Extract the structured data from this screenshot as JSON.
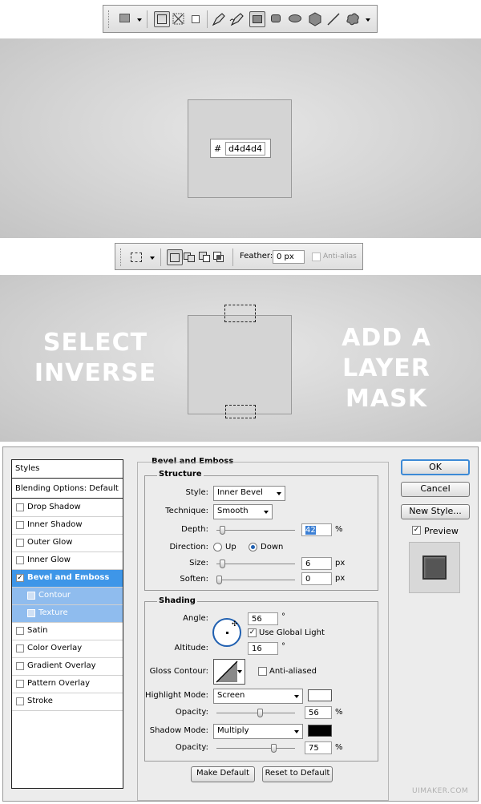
{
  "toolbar1": {
    "icons": [
      "shape-preset-icon",
      "shape-layers-icon",
      "paths-icon",
      "fill-pixels-icon",
      "pen-icon",
      "freeform-pen-icon",
      "rectangle-icon",
      "rounded-rectangle-icon",
      "ellipse-icon",
      "polygon-icon",
      "line-icon",
      "custom-shape-icon"
    ]
  },
  "step1": {
    "hash": "#",
    "hex": "d4d4d4",
    "fill_color": "#d4d4d4"
  },
  "toolbar2": {
    "feather_label": "Feather:",
    "feather_value": "0 px",
    "antialias_label": "Anti-alias"
  },
  "step2": {
    "left_text_line1": "SELECT",
    "left_text_line2": "INVERSE",
    "right_text_line1": "ADD A",
    "right_text_line2": "LAYER MASK"
  },
  "dialog": {
    "styles_header": "Styles",
    "blending": "Blending Options: Default",
    "items": [
      {
        "label": "Drop Shadow",
        "checked": false
      },
      {
        "label": "Inner Shadow",
        "checked": false
      },
      {
        "label": "Outer Glow",
        "checked": false
      },
      {
        "label": "Inner Glow",
        "checked": false
      },
      {
        "label": "Bevel and Emboss",
        "checked": true
      },
      {
        "label": "Contour",
        "checked": false
      },
      {
        "label": "Texture",
        "checked": false
      },
      {
        "label": "Satin",
        "checked": false
      },
      {
        "label": "Color Overlay",
        "checked": false
      },
      {
        "label": "Gradient Overlay",
        "checked": false
      },
      {
        "label": "Pattern Overlay",
        "checked": false
      },
      {
        "label": "Stroke",
        "checked": false
      }
    ],
    "section_title": "Bevel and Emboss",
    "structure": {
      "title": "Structure",
      "style_label": "Style:",
      "style_value": "Inner Bevel",
      "technique_label": "Technique:",
      "technique_value": "Smooth",
      "depth_label": "Depth:",
      "depth_value": "42",
      "depth_unit": "%",
      "depth_level": 0.04,
      "direction_label": "Direction:",
      "up_label": "Up",
      "down_label": "Down",
      "direction_value": "Down",
      "size_label": "Size:",
      "size_value": "6",
      "size_unit": "px",
      "size_level": 0.04,
      "soften_label": "Soften:",
      "soften_value": "0",
      "soften_unit": "px",
      "soften_level": 0.0
    },
    "shading": {
      "title": "Shading",
      "angle_label": "Angle:",
      "angle_value": "56",
      "angle_unit": "°",
      "global_light_label": "Use Global Light",
      "global_light": true,
      "altitude_label": "Altitude:",
      "altitude_value": "16",
      "altitude_unit": "°",
      "gloss_label": "Gloss Contour:",
      "antialiased_label": "Anti-aliased",
      "highlight_label": "Highlight Mode:",
      "highlight_value": "Screen",
      "highlight_color": "#ffffff",
      "opacity1_label": "Opacity:",
      "opacity1_value": "56",
      "opacity1_unit": "%",
      "opacity1_level": 0.56,
      "shadow_label": "Shadow Mode:",
      "shadow_value": "Multiply",
      "shadow_color": "#000000",
      "opacity2_label": "Opacity:",
      "opacity2_value": "75",
      "opacity2_unit": "%",
      "opacity2_level": 0.75
    },
    "make_default": "Make Default",
    "reset_default": "Reset to Default",
    "ok": "OK",
    "cancel": "Cancel",
    "new_style": "New Style...",
    "preview_label": "Preview",
    "preview": true
  },
  "watermark": "UIMAKER.COM"
}
